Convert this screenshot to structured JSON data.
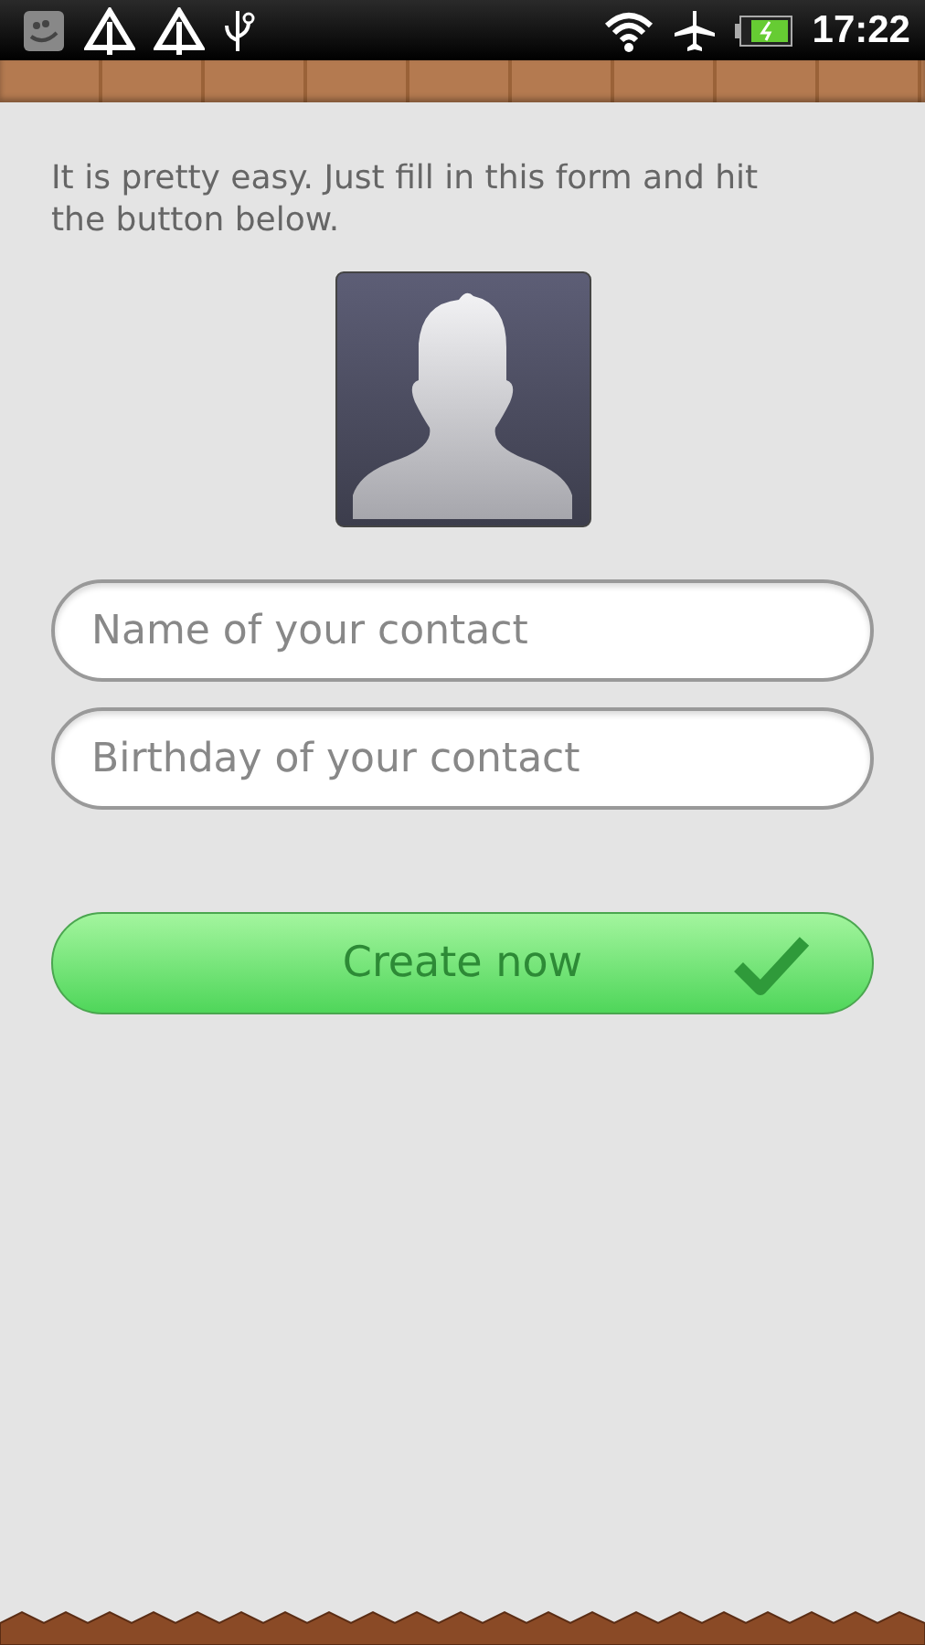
{
  "status_bar": {
    "time": "17:22"
  },
  "intro": "It is pretty easy. Just fill in this form and hit the button below.",
  "fields": [
    {
      "placeholder": "Name of your contact"
    },
    {
      "placeholder": "Birthday of your contact"
    }
  ],
  "button": {
    "label": "Create now"
  }
}
